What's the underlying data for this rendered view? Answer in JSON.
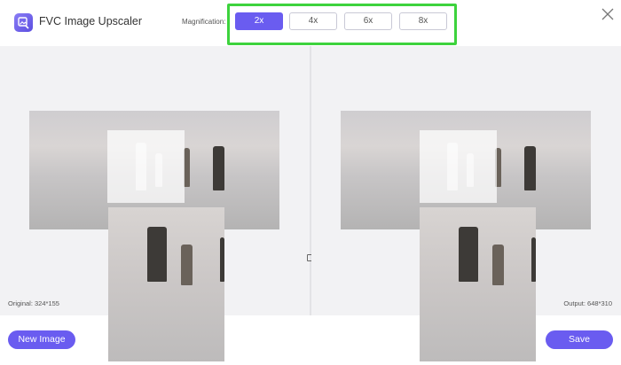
{
  "header": {
    "app_title": "FVC Image Upscaler",
    "magnification_label": "Magnification:",
    "magnification_options": [
      "2x",
      "4x",
      "6x",
      "8x"
    ],
    "selected_magnification": "2x"
  },
  "preview": {
    "original_label": "Original: 324*155",
    "output_label": "Output: 648*310"
  },
  "footer": {
    "new_image_label": "New Image",
    "save_label": "Save"
  },
  "colors": {
    "accent": "#6a5cf0",
    "highlight": "#3dd33d"
  }
}
